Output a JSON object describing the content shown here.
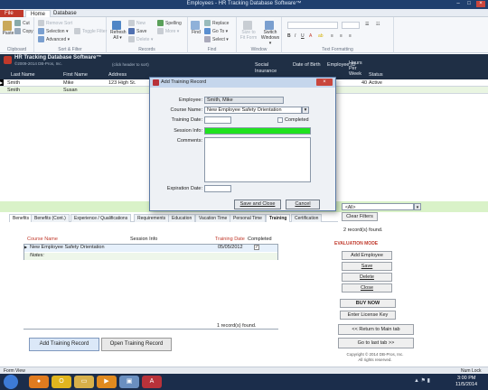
{
  "window": {
    "title": "Employees - HR Tracking Database Software™"
  },
  "ribbon_tabs": [
    "File",
    "Home",
    "Database"
  ],
  "ribbon": {
    "clipboard": {
      "paste": "Paste",
      "cut": "Cut",
      "copy": "Copy",
      "label": "Clipboard"
    },
    "sort_filter": {
      "remove_sort": "Remove Sort",
      "selection": "Selection ▾",
      "advanced": "Advanced ▾",
      "toggle_filter": "Toggle Filter",
      "label": "Sort & Filter"
    },
    "records": {
      "refresh": "Refresh All ▾",
      "new": "New",
      "save": "Save",
      "delete": "Delete ▾",
      "more": "More ▾",
      "spelling": "Spelling",
      "label": "Records"
    },
    "find": {
      "find": "Find",
      "replace": "Replace",
      "goto": "Go To ▾",
      "select": "Select ▾",
      "label": "Find"
    },
    "window": {
      "size_to_fit": "Size to Fit Form",
      "switch": "Switch Windows ▾",
      "label": "Window"
    },
    "text_formatting": {
      "label": "Text Formatting"
    }
  },
  "app_header": {
    "name": "HR Tracking Database Software™",
    "copyright": "©2009-2014 DB-Pros, Inc.",
    "sort_hint": "(click header to sort)",
    "columns": [
      "Last Name",
      "First Name",
      "Address",
      "Social Insurance",
      "Date of Birth",
      "Employee ID",
      "Hours Per Week",
      "Status"
    ]
  },
  "employees": [
    {
      "last": "Smith",
      "first": "Mike",
      "address": "123 High St.",
      "hours": "40",
      "status": "Active"
    },
    {
      "last": "Smith",
      "first": "Susan",
      "address": "",
      "hours": "",
      "status": ""
    }
  ],
  "filter": {
    "all": "<All>",
    "clear_filters": "Clear Filters"
  },
  "records_found": "2 record(s) found.",
  "lower_tabs": [
    "Benefits",
    "Benefits (Cont.)",
    "Experience / Qualifications",
    "Requirements",
    "Education",
    "Vacation Time",
    "Personal Time",
    "Training",
    "Certification"
  ],
  "training": {
    "headers": {
      "course": "Course Name",
      "session": "Session Info",
      "date": "Training Date",
      "completed": "Completed"
    },
    "rows": [
      {
        "course": "New Employee Safety Orientation",
        "date": "05/05/2012",
        "completed": "✓",
        "notes": "Notes:"
      }
    ],
    "records_found": "1 record(s) found.",
    "add_button": "Add Training Record",
    "open_button": "Open Training Record"
  },
  "side_panel": {
    "mode": "EVALUATION MODE",
    "add_employee": "Add Employee",
    "save": "Save",
    "delete": "Delete",
    "close": "Close",
    "buy_now": "BUY NOW",
    "license": "Enter License Key",
    "return_main": "<< Return to Main tab",
    "last_tab": "Go to last tab >>",
    "copyright": "Copyright © 2014 DB-Pros, Inc.",
    "rights": "All rights reserved."
  },
  "dialog": {
    "title": "Add Training Record",
    "employee_label": "Employee:",
    "employee_value": "Smith, Mike",
    "course_label": "Course Name:",
    "course_value": "New Employee Safety Orientation",
    "date_label": "Training Date:",
    "completed_label": "Completed",
    "session_label": "Session Info:",
    "comments_label": "Comments:",
    "expiration_label": "Expiration Date:",
    "save_close": "Save and Close",
    "cancel": "Cancel",
    "session_color": "#1fe21f"
  },
  "status_bar": {
    "left": "Form View",
    "right": "Num Lock"
  },
  "taskbar": {
    "time": "3:00 PM",
    "date": "11/5/2014"
  }
}
